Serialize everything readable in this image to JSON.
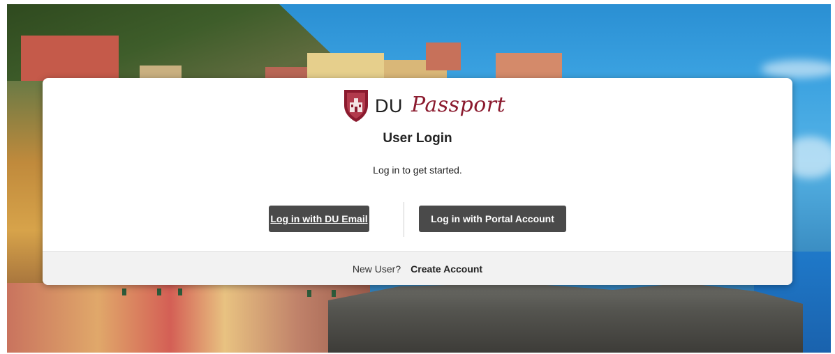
{
  "logo": {
    "brand_short": "DU",
    "brand_script": "Passport",
    "shield_icon": "shield-crest-icon",
    "brand_color": "#8b1a2e"
  },
  "login": {
    "title": "User Login",
    "subtitle": "Log in to get started.",
    "du_email_button": "Log in with DU Email",
    "portal_button": "Log in with Portal Account",
    "button_color": "#4a4a4a"
  },
  "footer": {
    "new_user_text": "New User?",
    "create_account_link": "Create Account"
  }
}
